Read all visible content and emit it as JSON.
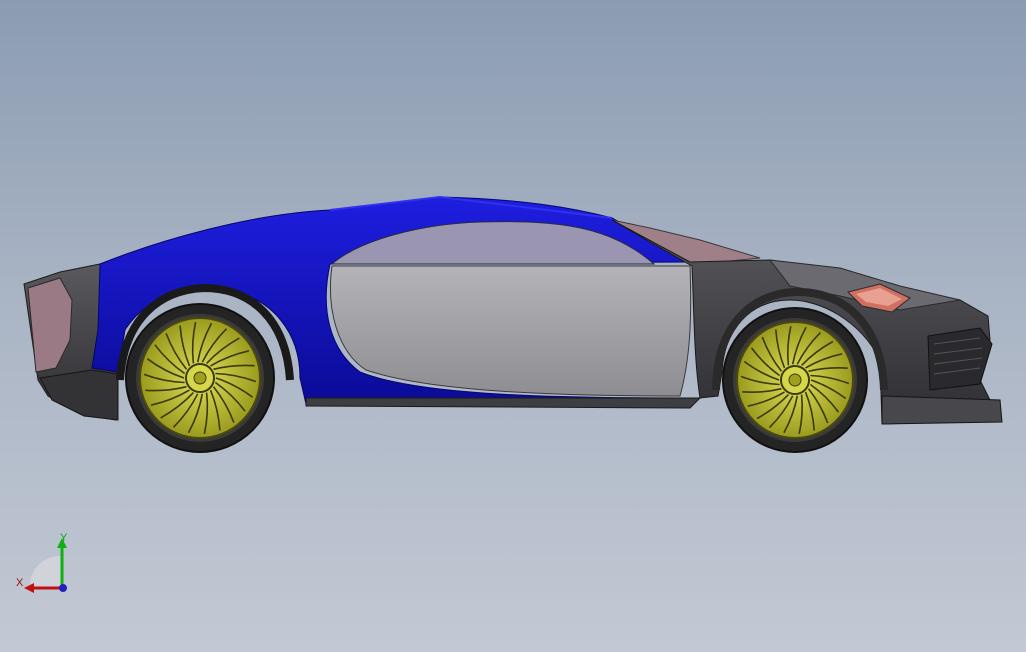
{
  "viewport": {
    "background_top": "#8b9cb2",
    "background_bottom": "#c3c9d4"
  },
  "model": {
    "colors": {
      "body_blue": "#1414c8",
      "body_blue_dark": "#0a0a8c",
      "door_gray": "#a8a8ac",
      "window": "#9a96b4",
      "carbon": "#3c3c40",
      "carbon_light": "#5a5a60",
      "rim_yellow": "#c8c832",
      "tire": "#2a2a2a",
      "pink_panel": "#a08088"
    }
  },
  "triad": {
    "x_label": "X",
    "y_label": "Y",
    "x_color": "#c01010",
    "y_color": "#10b010",
    "z_color": "#2020c0"
  }
}
